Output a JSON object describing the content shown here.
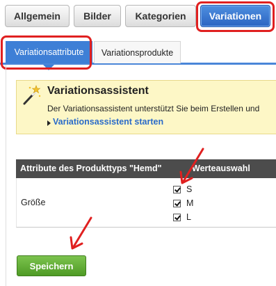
{
  "top_tabs": [
    {
      "label": "Allgemein"
    },
    {
      "label": "Bilder"
    },
    {
      "label": "Kategorien"
    },
    {
      "label": "Variationen",
      "active": true
    }
  ],
  "sub_tabs": [
    {
      "label": "Variationsattribute",
      "active": true
    },
    {
      "label": "Variationsprodukte"
    }
  ],
  "assistant": {
    "title": "Variationsassistent",
    "description": "Der Variationsassistent unterstützt Sie beim Erstellen und",
    "link": "Variationsassistent starten"
  },
  "table": {
    "headers": [
      "Attribute des Produkttyps \"Hemd\"",
      "Werteauswahl"
    ],
    "rows": [
      {
        "attribute": "Größe",
        "values": [
          {
            "label": "S",
            "checked": true
          },
          {
            "label": "M",
            "checked": true
          },
          {
            "label": "L",
            "checked": true
          }
        ]
      }
    ]
  },
  "buttons": {
    "save": "Speichern"
  },
  "colors": {
    "active_tab": "#3e7fd6",
    "highlight": "#e02020",
    "save_button": "#5aa82e",
    "link": "#2a6bc9",
    "assistant_bg": "#fdf7c6",
    "table_header": "#4c4c4c"
  },
  "icons": {
    "assistant": "magic-wand-icon",
    "link_arrow": "triangle-right-icon"
  }
}
